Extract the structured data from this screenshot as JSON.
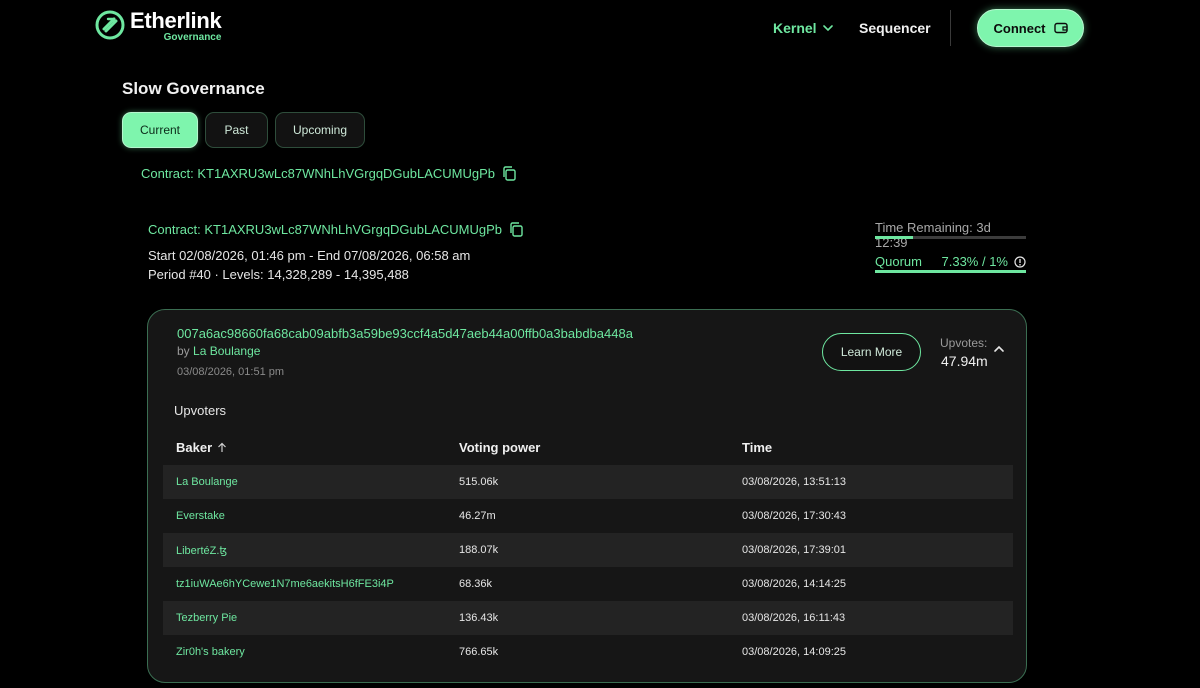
{
  "header": {
    "logo_name": "Etherlink",
    "logo_sub": "Governance",
    "nav_kernel": "Kernel",
    "nav_sequencer": "Sequencer",
    "connect_label": "Connect"
  },
  "page": {
    "title": "Slow Governance",
    "tabs": [
      {
        "label": "Current",
        "active": true
      },
      {
        "label": "Past",
        "active": false
      },
      {
        "label": "Upcoming",
        "active": false
      }
    ],
    "contract_label": "Contract: KT1AXRU3wLc87WNhLhVGrgqDGubLACUMUgPb"
  },
  "period": {
    "contract_label": "Contract: KT1AXRU3wLc87WNhLhVGrgqDGubLACUMUgPb",
    "dates": "Start 02/08/2026, 01:46 pm - End 07/08/2026, 06:58 am",
    "levels": "Period #40 · Levels: 14,328,289 - 14,395,488",
    "time_remaining": "Time Remaining: 3d 12:39",
    "time_progress": 0.25,
    "quorum_label": "Quorum",
    "quorum_value": "7.33% / 1%"
  },
  "proposal": {
    "hash": "007a6ac98660fa68cab09abfb3a59be93ccf4a5d47aeb44a00ffb0a3babdba448a",
    "by_prefix": "by",
    "author": "La Boulange",
    "date": "03/08/2026, 01:51 pm",
    "learn_more": "Learn More",
    "upvotes_label": "Upvotes:",
    "upvotes_value": "47.94m",
    "upvoters_title": "Upvoters",
    "table": {
      "headers": [
        "Baker",
        "Voting power",
        "Time"
      ],
      "rows": [
        {
          "baker": "La Boulange",
          "power": "515.06k",
          "time": "03/08/2026, 13:51:13"
        },
        {
          "baker": "Everstake",
          "power": "46.27m",
          "time": "03/08/2026, 17:30:43"
        },
        {
          "baker": "LibertéZ.ꜩ",
          "power": "188.07k",
          "time": "03/08/2026, 17:39:01"
        },
        {
          "baker": "tz1iuWAe6hYCewe1N7me6aekitsH6fFE3i4P",
          "power": "68.36k",
          "time": "03/08/2026, 14:14:25"
        },
        {
          "baker": "Tezberry Pie",
          "power": "136.43k",
          "time": "03/08/2026, 16:11:43"
        },
        {
          "baker": "Zir0h's bakery",
          "power": "766.65k",
          "time": "03/08/2026, 14:09:25"
        }
      ]
    }
  },
  "colors": {
    "accent": "#6ee7a0",
    "background": "#000000",
    "card": "#161616"
  }
}
